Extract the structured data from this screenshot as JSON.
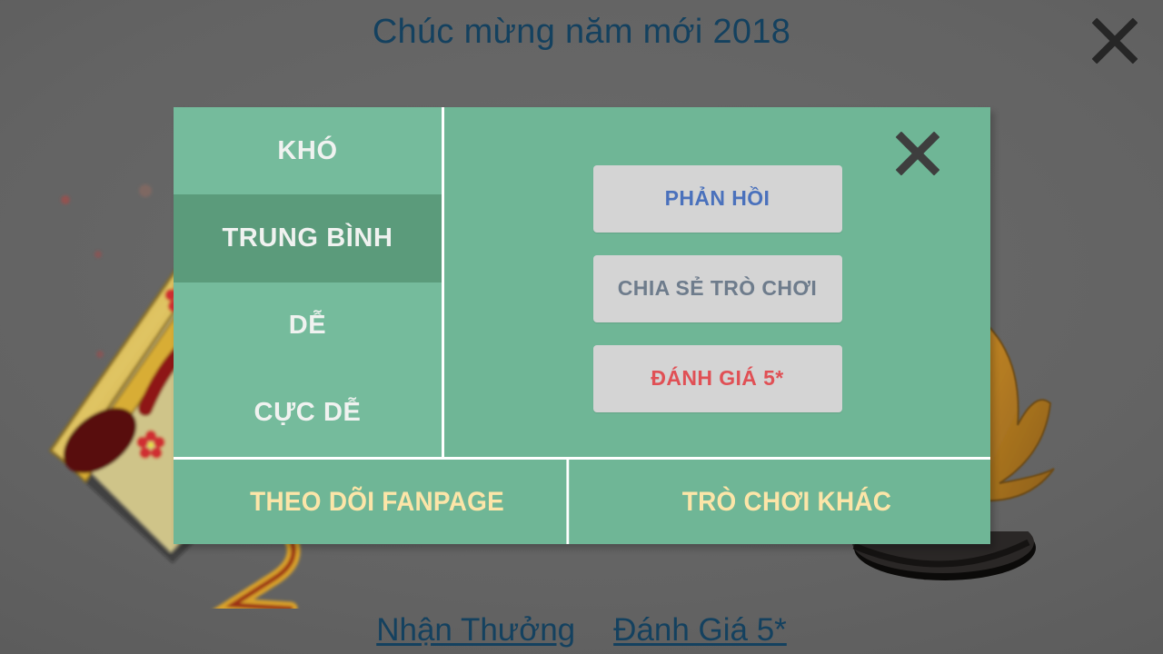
{
  "page": {
    "title": "Chúc mừng năm mới 2018",
    "background_color": "#636363",
    "title_color": "#14415f"
  },
  "top_close": {
    "icon": "close-x-icon",
    "color": "#262626"
  },
  "modal": {
    "background_color": "#6fb696",
    "divider_color": "#ffffff",
    "close": {
      "icon": "close-x-icon",
      "color": "#3e3e3e"
    },
    "difficulty": {
      "selected_index": 1,
      "selected_color": "#5b9b7b",
      "item_color": "#75bb9c",
      "text_color": "#f0f2f0",
      "items": [
        {
          "label": "KHÓ",
          "selected": false
        },
        {
          "label": "TRUNG BÌNH",
          "selected": true
        },
        {
          "label": "DỄ",
          "selected": false
        },
        {
          "label": "CỰC DỄ",
          "selected": false
        }
      ]
    },
    "actions": {
      "button_background": "#d4d4d4",
      "items": [
        {
          "label": "PHẢN HỒI",
          "color": "#4a71bc",
          "style": "feedback"
        },
        {
          "label": "CHIA SẺ TRÒ CHƠI",
          "color": "#6e7c8c",
          "style": "share"
        },
        {
          "label": "ĐÁNH GIÁ 5*",
          "color": "#e05055",
          "style": "rate"
        }
      ]
    },
    "footer": {
      "text_color": "#fce5a8",
      "items": [
        {
          "label": "THEO DÕI FANPAGE"
        },
        {
          "label": "TRÒ CHƠI KHÁC"
        }
      ]
    }
  },
  "bottom_links": {
    "color": "#14415f",
    "items": [
      {
        "label": "Nhận Thưởng"
      },
      {
        "label": "Đánh Giá 5*"
      }
    ]
  },
  "artwork": {
    "left": "lunar-new-year-fan-with-cherry-blossoms",
    "right": "year-of-the-dog-mascot-paw-robe-tail-shoe"
  }
}
